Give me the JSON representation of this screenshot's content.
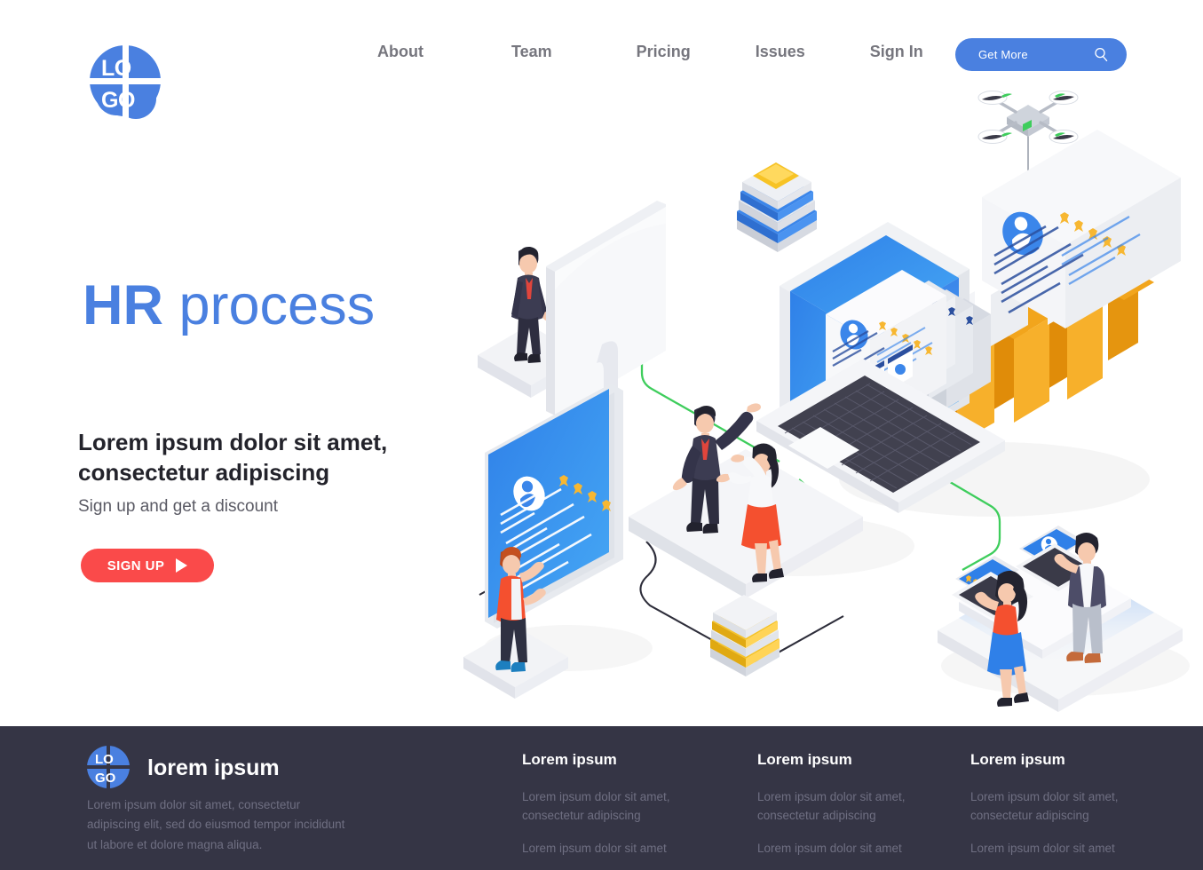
{
  "header": {
    "logo": {
      "top_text": "LO",
      "bottom_text": "GO",
      "color": "#4a80e0"
    },
    "nav": [
      {
        "label": "About"
      },
      {
        "label": "Team"
      },
      {
        "label": "Pricing"
      },
      {
        "label": "Issues"
      },
      {
        "label": "Sign In"
      }
    ],
    "cta": {
      "label": "Get More",
      "icon": "search-icon",
      "color": "#4a80e0"
    }
  },
  "hero": {
    "title_bold": "HR",
    "title_light": " process",
    "title_color": "#4a80e0",
    "subtitle": "Lorem ipsum dolor sit amet, consectetur adipiscing",
    "description": "Sign up and get a discount",
    "button": {
      "label": "SIGN UP",
      "icon": "play-icon",
      "color": "#fa4a4a"
    }
  },
  "illustration": {
    "theme": "isometric HR recruitment process",
    "elements": [
      "desktop-monitor-back",
      "businessman-suit-red-tie",
      "stacked-discs-yellow-blue",
      "laptop-with-cv-cards",
      "orange-folders-row",
      "drone-quadcopter",
      "cv-card-avatar-stars",
      "blue-screen-profile-rating",
      "person-orange-vest",
      "man-woman-gesturing-platform",
      "two-people-laptops-platform",
      "stacked-discs-yellow-white",
      "green-connector-line",
      "dark-connector-line"
    ],
    "colors": {
      "accent_blue": "#4a80e0",
      "screen_blue": "#3b8fe8",
      "folder_orange": "#f5a623",
      "star_gold": "#f7b731",
      "connector_green": "#3ecd5c",
      "connector_dark": "#2d2d3a",
      "skirt_red": "#f4502f",
      "suit_dark": "#3d3d52"
    },
    "star_rating": 5
  },
  "footer": {
    "background": "#353545",
    "logo": {
      "top_text": "LO",
      "bottom_text": "GO"
    },
    "brand": "lorem ipsum",
    "about": "Lorem ipsum dolor sit amet, consectetur adipiscing elit, sed do eiusmod tempor incididunt ut labore et dolore magna aliqua.",
    "columns": [
      {
        "title": "Lorem ipsum",
        "links": [
          "Lorem ipsum dolor sit amet, consectetur adipiscing",
          "Lorem ipsum dolor sit amet"
        ]
      },
      {
        "title": "Lorem ipsum",
        "links": [
          "Lorem ipsum dolor sit amet, consectetur adipiscing",
          "Lorem ipsum dolor sit amet"
        ]
      },
      {
        "title": "Lorem ipsum",
        "links": [
          "Lorem ipsum dolor sit amet, consectetur adipiscing",
          "Lorem ipsum dolor sit amet"
        ]
      }
    ]
  }
}
